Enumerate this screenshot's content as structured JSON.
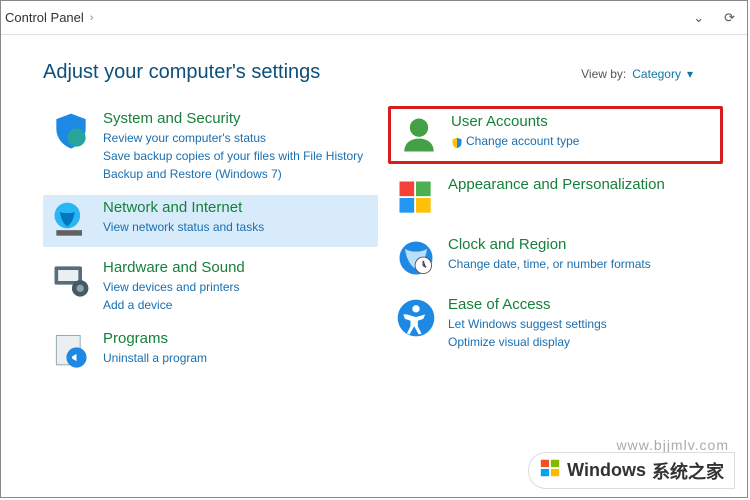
{
  "breadcrumb": {
    "root": "Control Panel"
  },
  "heading": "Adjust your computer's settings",
  "viewby": {
    "label": "View by:",
    "value": "Category"
  },
  "left": {
    "system": {
      "title": "System and Security",
      "l1": "Review your computer's status",
      "l2": "Save backup copies of your files with File History",
      "l3": "Backup and Restore (Windows 7)"
    },
    "network": {
      "title": "Network and Internet",
      "l1": "View network status and tasks"
    },
    "hardware": {
      "title": "Hardware and Sound",
      "l1": "View devices and printers",
      "l2": "Add a device"
    },
    "programs": {
      "title": "Programs",
      "l1": "Uninstall a program"
    }
  },
  "right": {
    "user": {
      "title": "User Accounts",
      "l1": "Change account type"
    },
    "appearance": {
      "title": "Appearance and Personalization"
    },
    "clock": {
      "title": "Clock and Region",
      "l1": "Change date, time, or number formats"
    },
    "ease": {
      "title": "Ease of Access",
      "l1": "Let Windows suggest settings",
      "l2": "Optimize visual display"
    }
  },
  "watermark": {
    "brand": "Windows",
    "brand_cn": "系统之家",
    "url": "www.bjjmlv.com"
  }
}
